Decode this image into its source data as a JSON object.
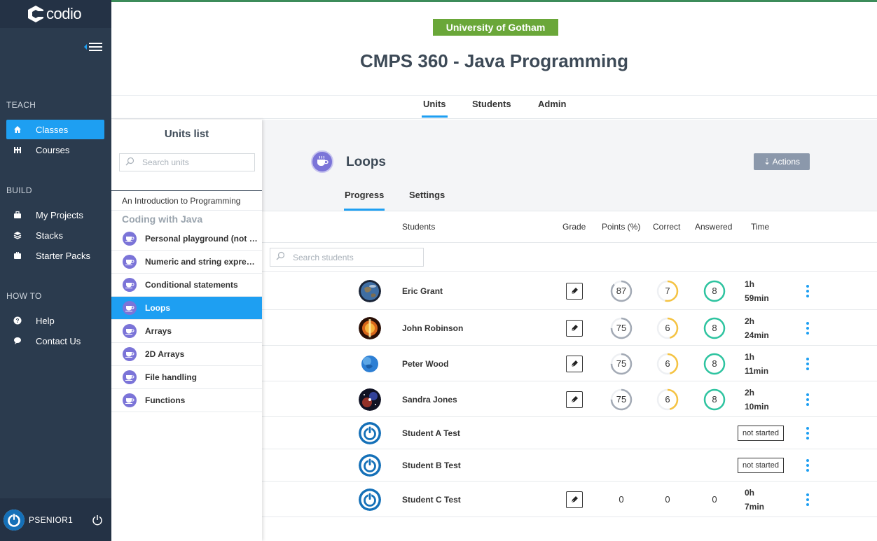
{
  "app": {
    "logo_text": "codio"
  },
  "sidebar": {
    "sections": [
      {
        "label": "TEACH",
        "items": [
          {
            "label": "Classes",
            "icon": "home-icon",
            "active": true
          },
          {
            "label": "Courses",
            "icon": "courses-icon"
          }
        ]
      },
      {
        "label": "BUILD",
        "items": [
          {
            "label": "My Projects",
            "icon": "briefcase-icon"
          },
          {
            "label": "Stacks",
            "icon": "stack-icon"
          },
          {
            "label": "Starter Packs",
            "icon": "package-icon"
          }
        ]
      },
      {
        "label": "HOW TO",
        "items": [
          {
            "label": "Help",
            "icon": "help-icon"
          },
          {
            "label": "Contact Us",
            "icon": "chat-icon"
          }
        ]
      }
    ],
    "user": {
      "name": "PSENIOR1"
    }
  },
  "header": {
    "badge": "University of Gotham",
    "title": "CMPS 360 - Java Programming",
    "tabs": [
      "Units",
      "Students",
      "Admin"
    ],
    "active_tab": "Units"
  },
  "units": {
    "title": "Units list",
    "search_placeholder": "Search units",
    "intro": "An Introduction to Programming",
    "group": "Coding with Java",
    "items": [
      "Personal playground (not graded)",
      "Numeric and string expressions",
      "Conditional statements",
      "Loops",
      "Arrays",
      "2D Arrays",
      "File handling",
      "Functions"
    ],
    "active": "Loops"
  },
  "unit": {
    "title": "Loops",
    "actions_label": "⇣ Actions",
    "tabs": [
      "Progress",
      "Settings"
    ],
    "active_tab": "Progress"
  },
  "table": {
    "headers": {
      "students": "Students",
      "grade": "Grade",
      "points": "Points (%)",
      "correct": "Correct",
      "answered": "Answered",
      "time": "Time"
    },
    "search_placeholder": "Search students",
    "rows": [
      {
        "name": "Eric Grant",
        "avatar": "earth",
        "points": "87",
        "correct": "7",
        "answered": "8",
        "time_h": "1h",
        "time_m": "59min"
      },
      {
        "name": "John Robinson",
        "avatar": "eclipse",
        "points": "75",
        "correct": "6",
        "answered": "8",
        "time_h": "2h",
        "time_m": "24min"
      },
      {
        "name": "Peter Wood",
        "avatar": "globe",
        "points": "75",
        "correct": "6",
        "answered": "8",
        "time_h": "1h",
        "time_m": "11min"
      },
      {
        "name": "Sandra Jones",
        "avatar": "nebula",
        "points": "75",
        "correct": "6",
        "answered": "8",
        "time_h": "2h",
        "time_m": "10min"
      },
      {
        "name": "Student A Test",
        "avatar": "power",
        "status": "not started"
      },
      {
        "name": "Student B Test",
        "avatar": "power",
        "status": "not started"
      },
      {
        "name": "Student C Test",
        "avatar": "power",
        "points": "0",
        "correct": "0",
        "answered": "0",
        "time_h": "0h",
        "time_m": "7min"
      }
    ]
  },
  "colors": {
    "accent": "#1e9ff2",
    "sidebar": "#2b3b4e",
    "badge": "#6aa739",
    "points_ring": "#a3aab5",
    "correct_ring": "#f5c342",
    "answered_ring": "#2ec4a0",
    "unit_icon": "#7b74d8"
  }
}
